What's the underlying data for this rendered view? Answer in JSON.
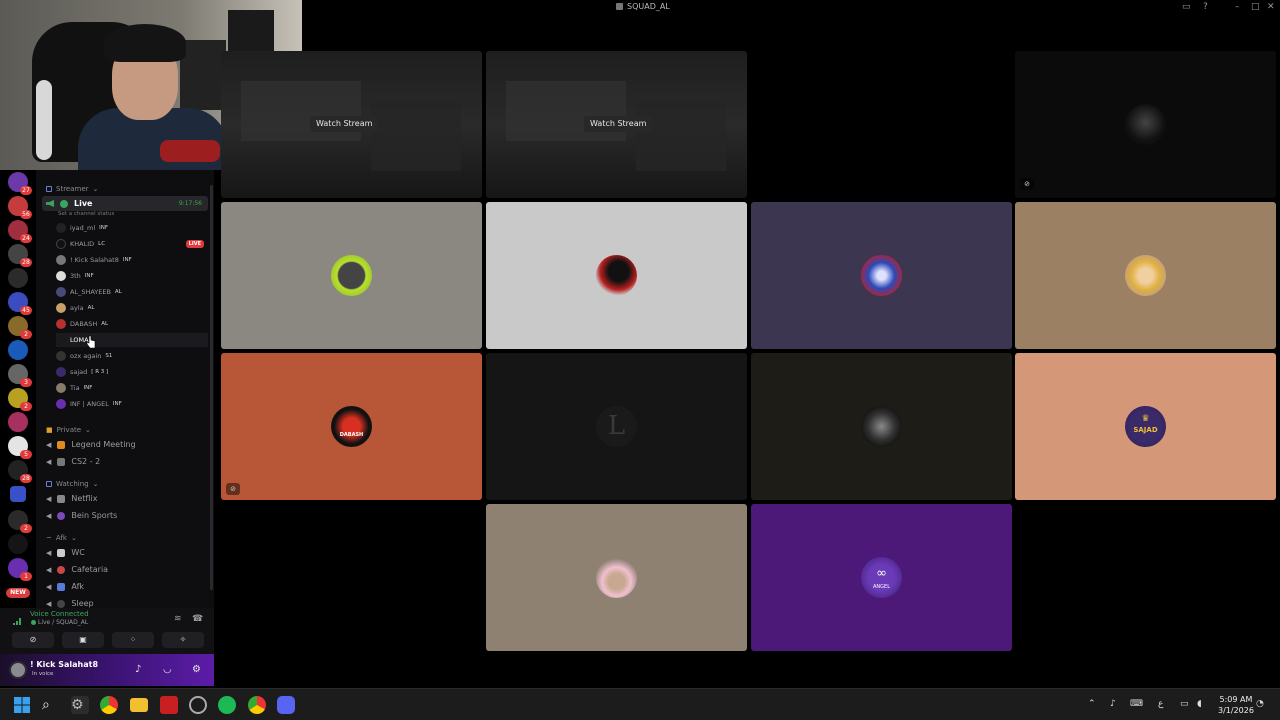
{
  "window": {
    "title": "SQUAD_AL"
  },
  "channels": {
    "categories": {
      "streamer": "Streamer",
      "private": "Private",
      "watching": "Watching",
      "afk": "Afk"
    },
    "live_channel": {
      "label": "Live",
      "time": "9:17:56",
      "status": "Set a channel status"
    },
    "members": [
      {
        "name": "iyad_ml",
        "tag": "INF",
        "live": false
      },
      {
        "name": "KHALID",
        "tag": "LC",
        "live": true
      },
      {
        "name": "! Kick Salahat8",
        "tag": "INF",
        "live": true
      },
      {
        "name": "3th",
        "tag": "INF",
        "live": false
      },
      {
        "name": "AL_SHAYEEB",
        "tag": "AL",
        "live": false
      },
      {
        "name": "ayla",
        "tag": "AL",
        "live": false
      },
      {
        "name": "DABASH",
        "tag": "AL",
        "live": false
      },
      {
        "name": "LOMA",
        "tag": "",
        "live": false
      },
      {
        "name": "ozx again",
        "tag": "S1",
        "live": false
      },
      {
        "name": "sajad",
        "tag": "[ R 3 ]",
        "live": false
      },
      {
        "name": "Tia",
        "tag": "INF",
        "live": false
      },
      {
        "name": "INF | ANGEL",
        "tag": "INF",
        "live": false
      }
    ],
    "live_badge": "LIVE",
    "private_channels": [
      "Legend Meeting",
      "CS2 - 2"
    ],
    "watching_channels": [
      "Netflix",
      "Bein Sports"
    ],
    "afk_channels": [
      "WC",
      "Cafetaria",
      "Afk",
      "Sleep"
    ]
  },
  "voice": {
    "status": "Voice Connected",
    "location": "Live / SQUAD_AL"
  },
  "user": {
    "name": "! Kick Salahat8",
    "status": "In voice"
  },
  "rail": {
    "new_badge": "NEW",
    "badges": [
      "27",
      "56",
      "24",
      "28",
      "45",
      "2",
      "3",
      "2",
      "5",
      "28",
      "2",
      "1"
    ]
  },
  "streams": {
    "watch_label": "Watch Stream",
    "tiles": [
      {
        "kind": "stream",
        "color": "#1e1e1e"
      },
      {
        "kind": "stream",
        "color": "#1e1e1e"
      },
      {
        "kind": "empty",
        "color": "#000000"
      },
      {
        "kind": "dark",
        "color": "#0b0b0b"
      },
      {
        "kind": "avatar",
        "color": "#8a8880"
      },
      {
        "kind": "avatar",
        "color": "#c9c9c9"
      },
      {
        "kind": "avatar",
        "color": "#3c3650"
      },
      {
        "kind": "avatar",
        "color": "#9c8064"
      },
      {
        "kind": "avatar",
        "color": "#b85638"
      },
      {
        "kind": "letter",
        "color": "#151515",
        "letter": "L"
      },
      {
        "kind": "avatar",
        "color": "#1e1c16"
      },
      {
        "kind": "avatar",
        "color": "#d49878"
      },
      {
        "kind": "avatar",
        "color": "#8f8172"
      },
      {
        "kind": "avatar",
        "color": "#4c1978"
      }
    ],
    "avatar_labels": {
      "dabash": "DABASH",
      "sajad": "SAJAD",
      "angel": "ANGEL"
    }
  },
  "taskbar": {
    "time": "5:09 AM",
    "date": "3/1/2026",
    "lang": "ع"
  }
}
